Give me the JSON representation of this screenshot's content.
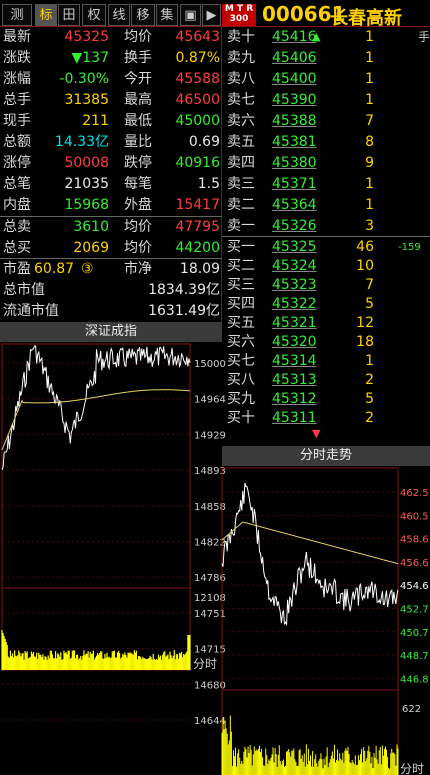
{
  "toolbar": [
    "测",
    "标",
    "田",
    "权",
    "线",
    "移",
    "集",
    "▣",
    "▶"
  ],
  "mtr": "M T R\n300",
  "stock": {
    "code": "000661",
    "name": "长春高新",
    "hand": "手"
  },
  "quote": [
    {
      "l": "最新",
      "v": "45325",
      "c": "red",
      "l2": "均价",
      "v2": "45643",
      "c2": "red"
    },
    {
      "l": "涨跌",
      "v": "▼137",
      "c": "green",
      "l2": "换手",
      "v2": "0.87%",
      "c2": "yellow"
    },
    {
      "l": "涨幅",
      "v": "-0.30%",
      "c": "green",
      "l2": "今开",
      "v2": "45588",
      "c2": "red"
    },
    {
      "l": "总手",
      "v": "31385",
      "c": "yellow",
      "l2": "最高",
      "v2": "46500",
      "c2": "red"
    },
    {
      "l": "现手",
      "v": "211",
      "c": "yellow",
      "l2": "最低",
      "v2": "45000",
      "c2": "green"
    },
    {
      "l": "总额",
      "v": "14.33亿",
      "c": "cyan",
      "l2": "量比",
      "v2": "0.69",
      "c2": "white"
    },
    {
      "l": "涨停",
      "v": "50008",
      "c": "red",
      "l2": "跌停",
      "v2": "40916",
      "c2": "green"
    },
    {
      "l": "总笔",
      "v": "21035",
      "c": "white",
      "l2": "每笔",
      "v2": "1.5",
      "c2": "white"
    },
    {
      "l": "内盘",
      "v": "15968",
      "c": "green",
      "l2": "外盘",
      "v2": "15417",
      "c2": "red"
    }
  ],
  "sums": [
    {
      "l": "总卖",
      "v": "3610",
      "c": "green",
      "l2": "均价",
      "v2": "47795",
      "c2": "red"
    },
    {
      "l": "总买",
      "v": "2069",
      "c": "yellow",
      "l2": "均价",
      "v2": "44200",
      "c2": "green"
    }
  ],
  "val": {
    "sy_l": "市盈",
    "sy_v": "60.87",
    "sy_badge": "③",
    "sj_l": "市净",
    "sj_v": "18.09",
    "zsz_l": "总市值",
    "zsz_v": "1834.39亿",
    "ltsz_l": "流通市值",
    "ltsz_v": "1631.49亿"
  },
  "sell": [
    {
      "l": "卖十",
      "p": "45416",
      "q": "1"
    },
    {
      "l": "卖九",
      "p": "45406",
      "q": "1"
    },
    {
      "l": "卖八",
      "p": "45400",
      "q": "1"
    },
    {
      "l": "卖七",
      "p": "45390",
      "q": "1"
    },
    {
      "l": "卖六",
      "p": "45388",
      "q": "7"
    },
    {
      "l": "卖五",
      "p": "45381",
      "q": "8"
    },
    {
      "l": "卖四",
      "p": "45380",
      "q": "9"
    },
    {
      "l": "卖三",
      "p": "45371",
      "q": "1"
    },
    {
      "l": "卖二",
      "p": "45364",
      "q": "1"
    },
    {
      "l": "卖一",
      "p": "45326",
      "q": "3"
    }
  ],
  "buy": [
    {
      "l": "买一",
      "p": "45325",
      "q": "46",
      "x": "-159"
    },
    {
      "l": "买二",
      "p": "45324",
      "q": "10",
      "x": ""
    },
    {
      "l": "买三",
      "p": "45323",
      "q": "7",
      "x": ""
    },
    {
      "l": "买四",
      "p": "45322",
      "q": "5",
      "x": ""
    },
    {
      "l": "买五",
      "p": "45321",
      "q": "12",
      "x": ""
    },
    {
      "l": "买六",
      "p": "45320",
      "q": "18",
      "x": ""
    },
    {
      "l": "买七",
      "p": "45314",
      "q": "1",
      "x": ""
    },
    {
      "l": "买八",
      "p": "45313",
      "q": "2",
      "x": ""
    },
    {
      "l": "买九",
      "p": "45312",
      "q": "5",
      "x": ""
    },
    {
      "l": "买十",
      "p": "45311",
      "q": "2",
      "x": ""
    }
  ],
  "index_chart": {
    "title": "深证成指",
    "axis": [
      "15000",
      "14964",
      "14929",
      "14893",
      "14858",
      "14822",
      "14786",
      "14751",
      "14715",
      "14680",
      "14644"
    ],
    "vol_label": "12108",
    "time_label": "分时"
  },
  "stock_chart": {
    "title": "分时走势",
    "axis": [
      "462.5",
      "460.5",
      "458.6",
      "456.6",
      "454.6",
      "452.7",
      "450.7",
      "448.7",
      "446.8"
    ],
    "vol_label": "622",
    "time_label": "分时"
  },
  "colors": {
    "up": "#ff3c3c",
    "down": "#33ee33",
    "avg": "#e6d36a",
    "price": "#ffffff",
    "grid": "#8a1010",
    "vol": "#ffff00"
  }
}
